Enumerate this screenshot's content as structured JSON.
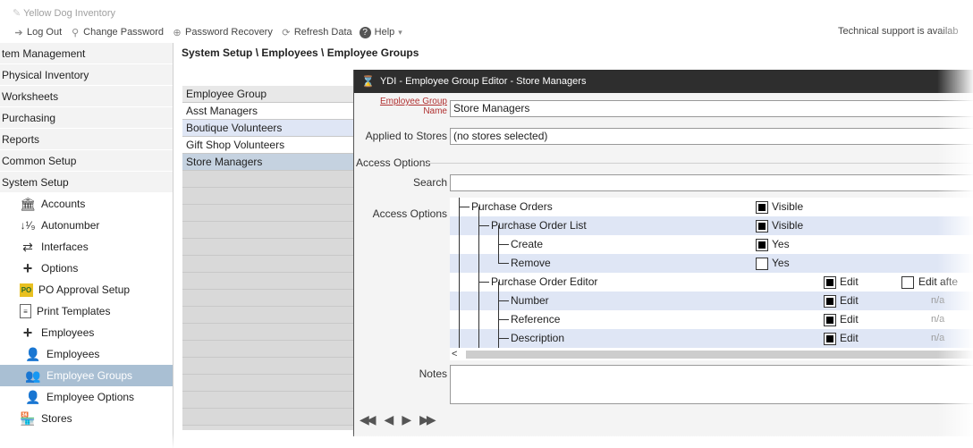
{
  "app": {
    "title": "Yellow Dog Inventory"
  },
  "toolbar": {
    "logout": "Log Out",
    "change_password": "Change Password",
    "password_recovery": "Password Recovery",
    "refresh": "Refresh Data",
    "help": "Help",
    "help_caret": "▾",
    "tech_support": "Technical support is availab"
  },
  "nav": {
    "top_items": [
      "tem Management",
      "Physical Inventory",
      "Worksheets",
      "Purchasing",
      "Reports",
      "Common Setup",
      "System Setup"
    ],
    "sub_items": [
      {
        "label": "Accounts",
        "icon": "bank-icon"
      },
      {
        "label": "Autonumber",
        "icon": "sort-numeric-icon"
      },
      {
        "label": "Interfaces",
        "icon": "arrows-exchange-icon"
      },
      {
        "label": "Options",
        "icon": "plus-icon"
      },
      {
        "label": "PO Approval Setup",
        "icon": "po-approval-icon"
      },
      {
        "label": "Print Templates",
        "icon": "document-icon"
      },
      {
        "label": "Employees",
        "icon": "plus-icon"
      },
      {
        "label": "Employees",
        "icon": "person-icon"
      },
      {
        "label": "Employee Groups",
        "icon": "people-group-icon"
      },
      {
        "label": "Employee Options",
        "icon": "person-gear-icon"
      },
      {
        "label": "Stores",
        "icon": "store-icon"
      }
    ]
  },
  "breadcrumb": "System Setup \\ Employees \\ Employee Groups",
  "group_list": {
    "header": "Employee Group",
    "rows": [
      "Asst Managers",
      "Boutique Volunteers",
      "Gift Shop Volunteers",
      "Store Managers"
    ]
  },
  "dialog": {
    "title": "YDI - Employee Group Editor - Store Managers",
    "name_label_1": "Employee Group",
    "name_label_2": "Name",
    "name_value": "Store Managers",
    "stores_label": "Applied to Stores",
    "stores_value": "(no stores selected)",
    "access_section": "Access Options",
    "search_label": "Search",
    "search_value": "",
    "access_label": "Access Options",
    "tree": [
      {
        "label": "Purchase Orders",
        "checked": true,
        "value": "Visible"
      },
      {
        "label": "Purchase Order List",
        "checked": true,
        "value": "Visible"
      },
      {
        "label": "Create",
        "checked": true,
        "value": "Yes"
      },
      {
        "label": "Remove",
        "checked": false,
        "value": "Yes"
      },
      {
        "label": "Purchase Order Editor",
        "checked": true,
        "value": "Edit",
        "extra_label": "Edit afte"
      },
      {
        "label": "Number",
        "checked": true,
        "value": "Edit",
        "extra_label": "n/a"
      },
      {
        "label": "Reference",
        "checked": true,
        "value": "Edit",
        "extra_label": "n/a"
      },
      {
        "label": "Description",
        "checked": true,
        "value": "Edit",
        "extra_label": "n/a"
      }
    ],
    "scroll_left": "<",
    "notes_label": "Notes",
    "pager": [
      "◀◀",
      "◀",
      "▶",
      "▶▶"
    ]
  }
}
